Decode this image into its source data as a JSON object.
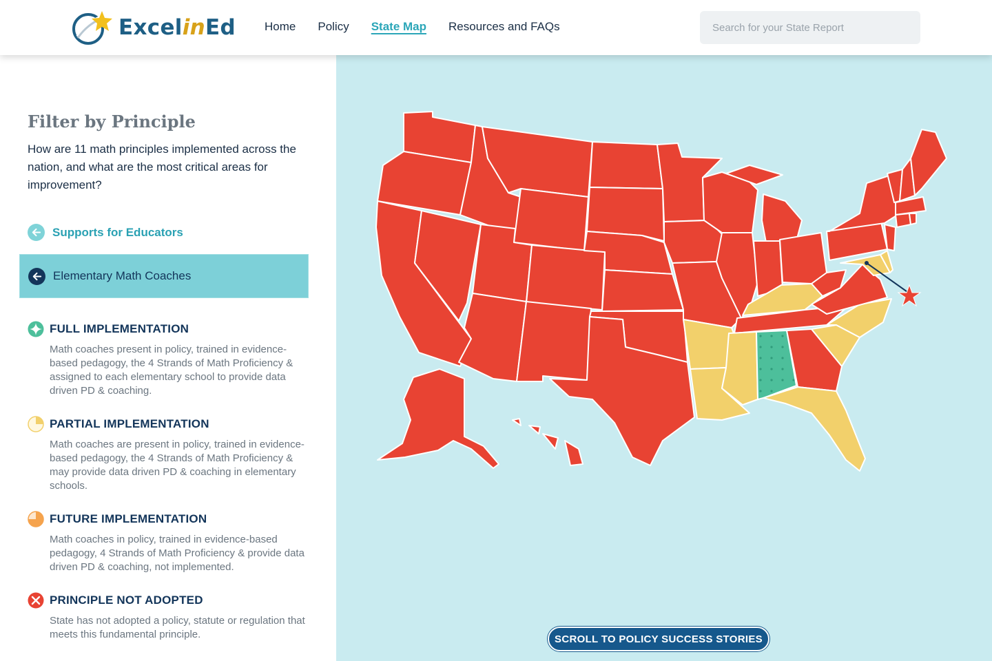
{
  "brand": {
    "logo_text_a": "Excel",
    "logo_text_b": "in",
    "logo_text_c": "Ed",
    "logo_icon": "star-swoosh-logo-icon"
  },
  "nav": {
    "home": "Home",
    "policy": "Policy",
    "state_map": "State Map",
    "resources": "Resources and FAQs",
    "active": "State Map"
  },
  "search": {
    "placeholder": "Search for your State Report"
  },
  "sidebar": {
    "filter_title": "Filter by Principle",
    "intro": "How are 11 math principles implemented across the nation, and what are the most critical areas for improvement?",
    "category": {
      "label": "Supports for Educators",
      "icon": "arrow-left-icon"
    },
    "selected_principle": {
      "label": "Elementary Math Coaches",
      "icon": "arrow-left-icon"
    }
  },
  "legend": [
    {
      "title": "FULL IMPLEMENTATION",
      "desc": "Math coaches present in policy, trained in evidence-based pedagogy, the 4 Strands of Math Proficiency & assigned to each elementary school to provide data driven PD & coaching.",
      "icon": "sparkle-icon",
      "color": "#4dbf9b"
    },
    {
      "title": "PARTIAL IMPLEMENTATION",
      "desc": "Math coaches are present in policy, trained in evidence-based pedagogy, the 4 Strands of Math Proficiency & may provide data driven PD & coaching in elementary schools.",
      "icon": "quarter-pie-icon",
      "color": "#f2d06b"
    },
    {
      "title": "FUTURE IMPLEMENTATION",
      "desc": "Math coaches in policy, trained in evidence-based pedagogy, 4 Strands of Math Proficiency & provide data driven PD & coaching, not implemented.",
      "icon": "half-pie-icon",
      "color": "#f5a34d"
    },
    {
      "title": "PRINCIPLE NOT ADOPTED",
      "desc": "State has not adopted a policy, statute or regulation that meets this fundamental principle.",
      "icon": "x-circle-icon",
      "color": "#e84333"
    }
  ],
  "map": {
    "colors": {
      "not_adopted": "#e84333",
      "partial": "#f2d06b",
      "full": "#4dbf9b",
      "water": "#c9ebf0",
      "border": "#ffffff"
    },
    "dc_marker_icon": "star-icon"
  },
  "scroll_button": {
    "label": "SCROLL TO POLICY SUCCESS STORIES"
  }
}
